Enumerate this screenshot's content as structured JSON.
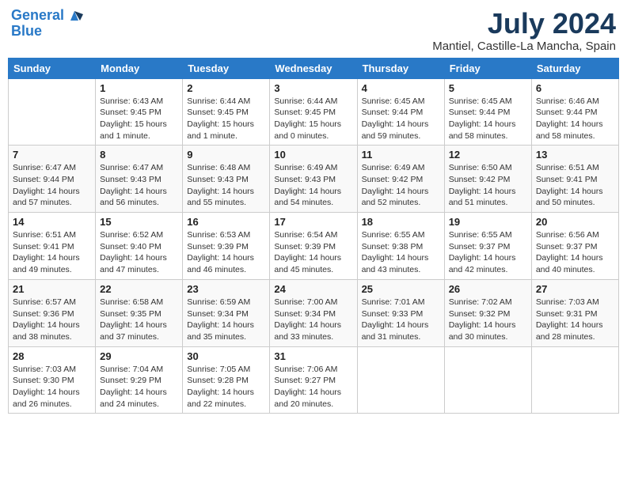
{
  "header": {
    "logo_line1": "General",
    "logo_line2": "Blue",
    "month_title": "July 2024",
    "location": "Mantiel, Castille-La Mancha, Spain"
  },
  "days_of_week": [
    "Sunday",
    "Monday",
    "Tuesday",
    "Wednesday",
    "Thursday",
    "Friday",
    "Saturday"
  ],
  "weeks": [
    [
      {
        "day": "",
        "content": ""
      },
      {
        "day": "1",
        "content": "Sunrise: 6:43 AM\nSunset: 9:45 PM\nDaylight: 15 hours\nand 1 minute."
      },
      {
        "day": "2",
        "content": "Sunrise: 6:44 AM\nSunset: 9:45 PM\nDaylight: 15 hours\nand 1 minute."
      },
      {
        "day": "3",
        "content": "Sunrise: 6:44 AM\nSunset: 9:45 PM\nDaylight: 15 hours\nand 0 minutes."
      },
      {
        "day": "4",
        "content": "Sunrise: 6:45 AM\nSunset: 9:44 PM\nDaylight: 14 hours\nand 59 minutes."
      },
      {
        "day": "5",
        "content": "Sunrise: 6:45 AM\nSunset: 9:44 PM\nDaylight: 14 hours\nand 58 minutes."
      },
      {
        "day": "6",
        "content": "Sunrise: 6:46 AM\nSunset: 9:44 PM\nDaylight: 14 hours\nand 58 minutes."
      }
    ],
    [
      {
        "day": "7",
        "content": "Sunrise: 6:47 AM\nSunset: 9:44 PM\nDaylight: 14 hours\nand 57 minutes."
      },
      {
        "day": "8",
        "content": "Sunrise: 6:47 AM\nSunset: 9:43 PM\nDaylight: 14 hours\nand 56 minutes."
      },
      {
        "day": "9",
        "content": "Sunrise: 6:48 AM\nSunset: 9:43 PM\nDaylight: 14 hours\nand 55 minutes."
      },
      {
        "day": "10",
        "content": "Sunrise: 6:49 AM\nSunset: 9:43 PM\nDaylight: 14 hours\nand 54 minutes."
      },
      {
        "day": "11",
        "content": "Sunrise: 6:49 AM\nSunset: 9:42 PM\nDaylight: 14 hours\nand 52 minutes."
      },
      {
        "day": "12",
        "content": "Sunrise: 6:50 AM\nSunset: 9:42 PM\nDaylight: 14 hours\nand 51 minutes."
      },
      {
        "day": "13",
        "content": "Sunrise: 6:51 AM\nSunset: 9:41 PM\nDaylight: 14 hours\nand 50 minutes."
      }
    ],
    [
      {
        "day": "14",
        "content": "Sunrise: 6:51 AM\nSunset: 9:41 PM\nDaylight: 14 hours\nand 49 minutes."
      },
      {
        "day": "15",
        "content": "Sunrise: 6:52 AM\nSunset: 9:40 PM\nDaylight: 14 hours\nand 47 minutes."
      },
      {
        "day": "16",
        "content": "Sunrise: 6:53 AM\nSunset: 9:39 PM\nDaylight: 14 hours\nand 46 minutes."
      },
      {
        "day": "17",
        "content": "Sunrise: 6:54 AM\nSunset: 9:39 PM\nDaylight: 14 hours\nand 45 minutes."
      },
      {
        "day": "18",
        "content": "Sunrise: 6:55 AM\nSunset: 9:38 PM\nDaylight: 14 hours\nand 43 minutes."
      },
      {
        "day": "19",
        "content": "Sunrise: 6:55 AM\nSunset: 9:37 PM\nDaylight: 14 hours\nand 42 minutes."
      },
      {
        "day": "20",
        "content": "Sunrise: 6:56 AM\nSunset: 9:37 PM\nDaylight: 14 hours\nand 40 minutes."
      }
    ],
    [
      {
        "day": "21",
        "content": "Sunrise: 6:57 AM\nSunset: 9:36 PM\nDaylight: 14 hours\nand 38 minutes."
      },
      {
        "day": "22",
        "content": "Sunrise: 6:58 AM\nSunset: 9:35 PM\nDaylight: 14 hours\nand 37 minutes."
      },
      {
        "day": "23",
        "content": "Sunrise: 6:59 AM\nSunset: 9:34 PM\nDaylight: 14 hours\nand 35 minutes."
      },
      {
        "day": "24",
        "content": "Sunrise: 7:00 AM\nSunset: 9:34 PM\nDaylight: 14 hours\nand 33 minutes."
      },
      {
        "day": "25",
        "content": "Sunrise: 7:01 AM\nSunset: 9:33 PM\nDaylight: 14 hours\nand 31 minutes."
      },
      {
        "day": "26",
        "content": "Sunrise: 7:02 AM\nSunset: 9:32 PM\nDaylight: 14 hours\nand 30 minutes."
      },
      {
        "day": "27",
        "content": "Sunrise: 7:03 AM\nSunset: 9:31 PM\nDaylight: 14 hours\nand 28 minutes."
      }
    ],
    [
      {
        "day": "28",
        "content": "Sunrise: 7:03 AM\nSunset: 9:30 PM\nDaylight: 14 hours\nand 26 minutes."
      },
      {
        "day": "29",
        "content": "Sunrise: 7:04 AM\nSunset: 9:29 PM\nDaylight: 14 hours\nand 24 minutes."
      },
      {
        "day": "30",
        "content": "Sunrise: 7:05 AM\nSunset: 9:28 PM\nDaylight: 14 hours\nand 22 minutes."
      },
      {
        "day": "31",
        "content": "Sunrise: 7:06 AM\nSunset: 9:27 PM\nDaylight: 14 hours\nand 20 minutes."
      },
      {
        "day": "",
        "content": ""
      },
      {
        "day": "",
        "content": ""
      },
      {
        "day": "",
        "content": ""
      }
    ]
  ]
}
